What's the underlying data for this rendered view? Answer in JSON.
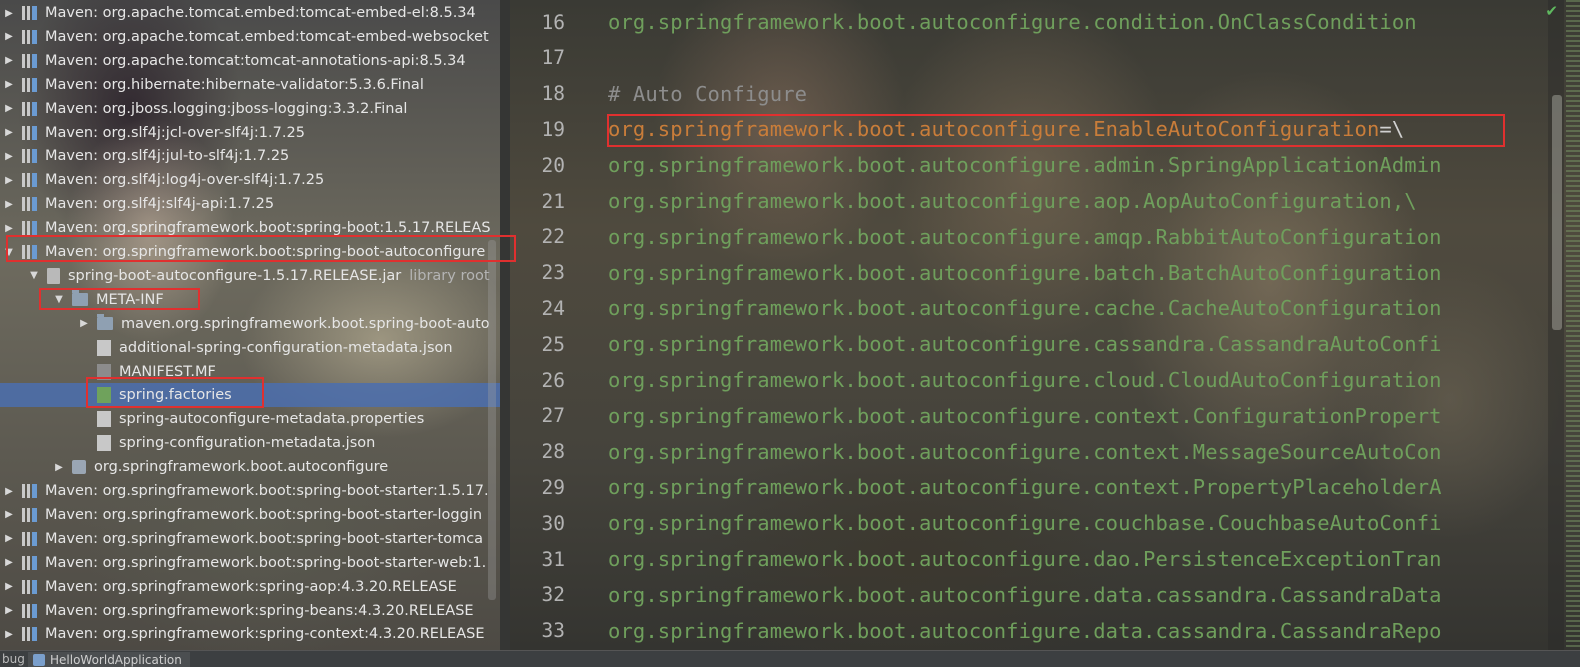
{
  "tree": {
    "rows": [
      {
        "label": "Maven: org.apache.tomcat.embed:tomcat-embed-el:8.5.34",
        "kind": "library",
        "indent": 0,
        "expanded": false
      },
      {
        "label": "Maven: org.apache.tomcat.embed:tomcat-embed-websocket",
        "kind": "library",
        "indent": 0,
        "expanded": false
      },
      {
        "label": "Maven: org.apache.tomcat:tomcat-annotations-api:8.5.34",
        "kind": "library",
        "indent": 0,
        "expanded": false
      },
      {
        "label": "Maven: org.hibernate:hibernate-validator:5.3.6.Final",
        "kind": "library",
        "indent": 0,
        "expanded": false
      },
      {
        "label": "Maven: org.jboss.logging:jboss-logging:3.3.2.Final",
        "kind": "library",
        "indent": 0,
        "expanded": false
      },
      {
        "label": "Maven: org.slf4j:jcl-over-slf4j:1.7.25",
        "kind": "library",
        "indent": 0,
        "expanded": false
      },
      {
        "label": "Maven: org.slf4j:jul-to-slf4j:1.7.25",
        "kind": "library",
        "indent": 0,
        "expanded": false
      },
      {
        "label": "Maven: org.slf4j:log4j-over-slf4j:1.7.25",
        "kind": "library",
        "indent": 0,
        "expanded": false
      },
      {
        "label": "Maven: org.slf4j:slf4j-api:1.7.25",
        "kind": "library",
        "indent": 0,
        "expanded": false
      },
      {
        "label": "Maven: org.springframework.boot:spring-boot:1.5.17.RELEAS",
        "kind": "library",
        "indent": 0,
        "expanded": false
      },
      {
        "label": "Maven: org.springframework.boot:spring-boot-autoconfigure",
        "kind": "library",
        "indent": 0,
        "expanded": true
      },
      {
        "label": "spring-boot-autoconfigure-1.5.17.RELEASE.jar",
        "suffix": "library root",
        "kind": "jar",
        "indent": 1,
        "expanded": true
      },
      {
        "label": "META-INF",
        "kind": "folder",
        "indent": 2,
        "expanded": true
      },
      {
        "label": "maven.org.springframework.boot.spring-boot-auto",
        "kind": "folder",
        "indent": 3,
        "expanded": false
      },
      {
        "label": "additional-spring-configuration-metadata.json",
        "kind": "json",
        "indent": 3,
        "leaf": true
      },
      {
        "label": "MANIFEST.MF",
        "kind": "mf",
        "indent": 3,
        "leaf": true
      },
      {
        "label": "spring.factories",
        "kind": "factories",
        "indent": 3,
        "leaf": true,
        "selected": true
      },
      {
        "label": "spring-autoconfigure-metadata.properties",
        "kind": "props",
        "indent": 3,
        "leaf": true
      },
      {
        "label": "spring-configuration-metadata.json",
        "kind": "json",
        "indent": 3,
        "leaf": true
      },
      {
        "label": "org.springframework.boot.autoconfigure",
        "kind": "package",
        "indent": 2,
        "expanded": false
      },
      {
        "label": "Maven: org.springframework.boot:spring-boot-starter:1.5.17.",
        "kind": "library",
        "indent": 0,
        "expanded": false
      },
      {
        "label": "Maven: org.springframework.boot:spring-boot-starter-loggin",
        "kind": "library",
        "indent": 0,
        "expanded": false
      },
      {
        "label": "Maven: org.springframework.boot:spring-boot-starter-tomca",
        "kind": "library",
        "indent": 0,
        "expanded": false
      },
      {
        "label": "Maven: org.springframework.boot:spring-boot-starter-web:1.",
        "kind": "library",
        "indent": 0,
        "expanded": false
      },
      {
        "label": "Maven: org.springframework:spring-aop:4.3.20.RELEASE",
        "kind": "library",
        "indent": 0,
        "expanded": false
      },
      {
        "label": "Maven: org.springframework:spring-beans:4.3.20.RELEASE",
        "kind": "library",
        "indent": 0,
        "expanded": false
      },
      {
        "label": "Maven: org.springframework:spring-context:4.3.20.RELEASE",
        "kind": "library",
        "indent": 0,
        "expanded": false
      }
    ]
  },
  "editor": {
    "lines": [
      {
        "num": "16",
        "text": "org.springframework.boot.autoconfigure.condition.OnClassCondition",
        "kind": "code"
      },
      {
        "num": "17",
        "text": "",
        "kind": "code"
      },
      {
        "num": "18",
        "text": "# Auto Configure",
        "kind": "comment"
      },
      {
        "num": "19",
        "key": "org.springframework.boot.autoconfigure.EnableAutoConfiguration",
        "eq": "=\\",
        "kind": "key"
      },
      {
        "num": "20",
        "text": "org.springframework.boot.autoconfigure.admin.SpringApplicationAdmin",
        "kind": "code"
      },
      {
        "num": "21",
        "text": "org.springframework.boot.autoconfigure.aop.AopAutoConfiguration,\\",
        "kind": "code"
      },
      {
        "num": "22",
        "text": "org.springframework.boot.autoconfigure.amqp.RabbitAutoConfiguration",
        "kind": "code"
      },
      {
        "num": "23",
        "text": "org.springframework.boot.autoconfigure.batch.BatchAutoConfiguration",
        "kind": "code"
      },
      {
        "num": "24",
        "text": "org.springframework.boot.autoconfigure.cache.CacheAutoConfiguration",
        "kind": "code"
      },
      {
        "num": "25",
        "text": "org.springframework.boot.autoconfigure.cassandra.CassandraAutoConfi",
        "kind": "code"
      },
      {
        "num": "26",
        "text": "org.springframework.boot.autoconfigure.cloud.CloudAutoConfiguration",
        "kind": "code"
      },
      {
        "num": "27",
        "text": "org.springframework.boot.autoconfigure.context.ConfigurationPropert",
        "kind": "code"
      },
      {
        "num": "28",
        "text": "org.springframework.boot.autoconfigure.context.MessageSourceAutoCon",
        "kind": "code"
      },
      {
        "num": "29",
        "text": "org.springframework.boot.autoconfigure.context.PropertyPlaceholderA",
        "kind": "code"
      },
      {
        "num": "30",
        "text": "org.springframework.boot.autoconfigure.couchbase.CouchbaseAutoConfi",
        "kind": "code"
      },
      {
        "num": "31",
        "text": "org.springframework.boot.autoconfigure.dao.PersistenceExceptionTran",
        "kind": "code"
      },
      {
        "num": "32",
        "text": "org.springframework.boot.autoconfigure.data.cassandra.CassandraData",
        "kind": "code"
      },
      {
        "num": "33",
        "text": "org.springframework.boot.autoconfigure.data.cassandra.CassandraRepo",
        "kind": "code"
      }
    ]
  },
  "statusbar": {
    "left_text": "bug",
    "tab_label": "HelloWorldApplication"
  },
  "colors": {
    "highlight_box": "#e0302f",
    "selection": "#4b6eaf",
    "code_green": "#6f9f5c",
    "key_orange": "#c97d3a",
    "comment_gray": "#8d8d8d"
  }
}
